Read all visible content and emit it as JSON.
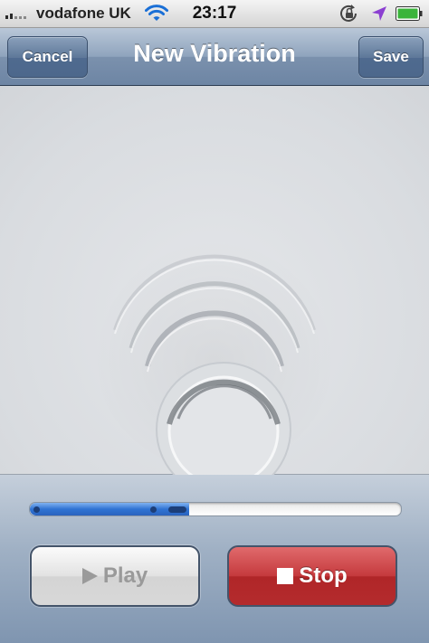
{
  "status_bar": {
    "carrier": "vodafone UK",
    "time": "23:17",
    "signal_icon": "signal-bars-icon",
    "wifi_icon": "wifi-icon",
    "rotation_lock_icon": "rotation-lock-icon",
    "location_icon": "location-arrow-icon",
    "battery_icon": "battery-icon"
  },
  "nav": {
    "cancel_label": "Cancel",
    "title": "New Vibration",
    "save_label": "Save"
  },
  "record_area": {
    "icon": "vibration-ripple-icon"
  },
  "progress": {
    "value": 0.43
  },
  "controls": {
    "play_label": "Play",
    "play_enabled": false,
    "stop_label": "Stop"
  },
  "colors": {
    "nav_bar": "#7b91ad",
    "progress_fill": "#2f73d3",
    "stop_button": "#c53a3d",
    "location_icon": "#8b3fd1"
  }
}
